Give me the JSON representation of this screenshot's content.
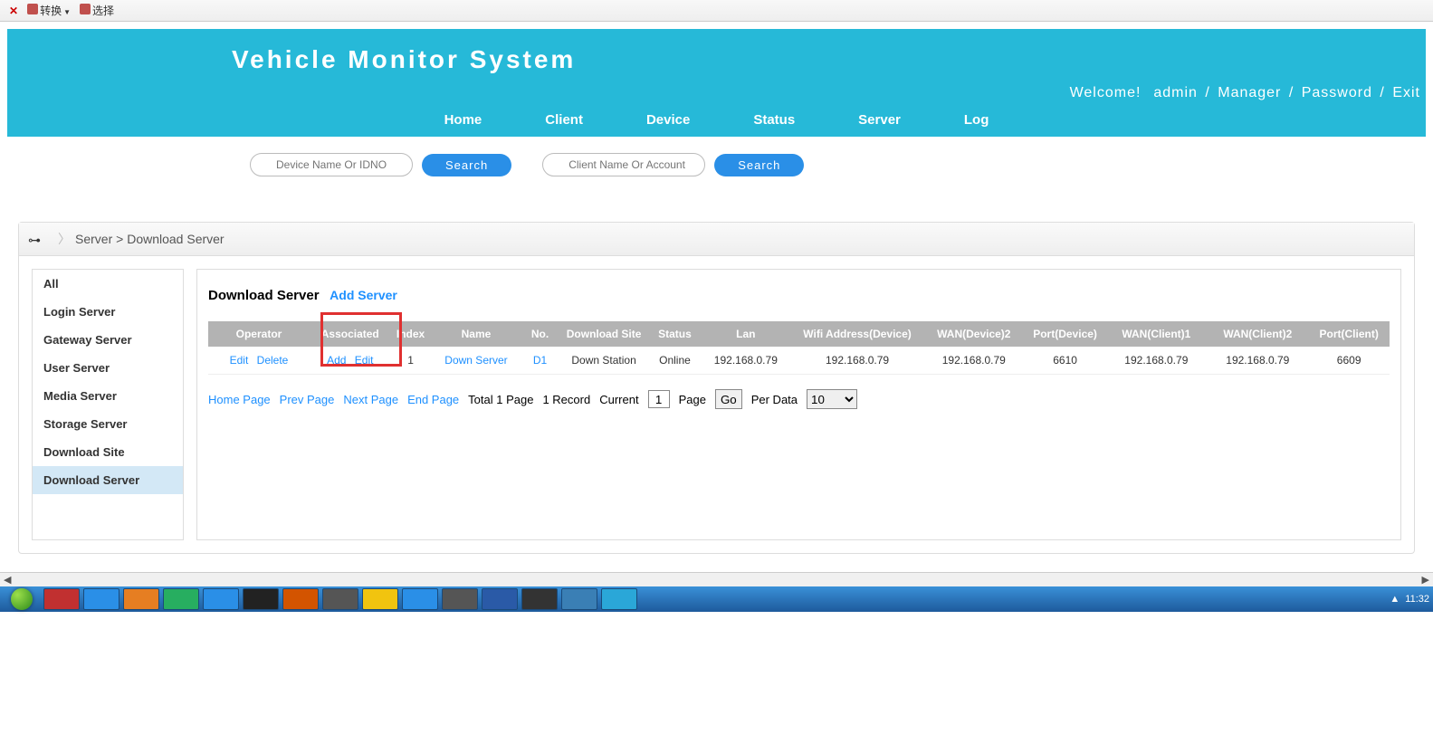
{
  "browser_bar": {
    "convert": "转换",
    "select": "选择"
  },
  "header": {
    "title": "Vehicle Monitor System",
    "welcome": "Welcome!",
    "user": "admin",
    "role": "Manager",
    "password": "Password",
    "exit": "Exit"
  },
  "nav": {
    "home": "Home",
    "client": "Client",
    "device": "Device",
    "status": "Status",
    "server": "Server",
    "log": "Log"
  },
  "search": {
    "device_placeholder": "Device Name Or IDNO",
    "client_placeholder": "Client Name Or Account",
    "button": "Search"
  },
  "breadcrumb": {
    "server": "Server",
    "download_server": "Download Server"
  },
  "sidebar": {
    "items": [
      {
        "label": "All"
      },
      {
        "label": "Login Server"
      },
      {
        "label": "Gateway Server"
      },
      {
        "label": "User Server"
      },
      {
        "label": "Media Server"
      },
      {
        "label": "Storage Server"
      },
      {
        "label": "Download Site"
      },
      {
        "label": "Download Server"
      }
    ]
  },
  "panel": {
    "title": "Download Server",
    "add_server": "Add Server"
  },
  "table": {
    "headers": {
      "operator": "Operator",
      "associated": "Associated",
      "index": "Index",
      "name": "Name",
      "no": "No.",
      "download_site": "Download Site",
      "status": "Status",
      "lan": "Lan",
      "wifi_addr_device": "Wifi Address(Device)",
      "wan_device2": "WAN(Device)2",
      "port_device": "Port(Device)",
      "wan_client1": "WAN(Client)1",
      "wan_client2": "WAN(Client)2",
      "port_client": "Port(Client)"
    },
    "rows": [
      {
        "op_edit": "Edit",
        "op_delete": "Delete",
        "assoc_add": "Add",
        "assoc_edit": "Edit",
        "index": "1",
        "name": "Down Server",
        "no": "D1",
        "download_site": "Down Station",
        "status": "Online",
        "lan": "192.168.0.79",
        "wifi_addr_device": "192.168.0.79",
        "wan_device2": "192.168.0.79",
        "port_device": "6610",
        "wan_client1": "192.168.0.79",
        "wan_client2": "192.168.0.79",
        "port_client": "6609"
      }
    ]
  },
  "pagination": {
    "home_page": "Home Page",
    "prev_page": "Prev Page",
    "next_page": "Next Page",
    "end_page": "End Page",
    "total": "Total 1 Page",
    "record": "1 Record",
    "current_label": "Current",
    "current_value": "1",
    "page_label": "Page",
    "go": "Go",
    "per_data": "Per Data",
    "per_data_value": "10"
  },
  "taskbar": {
    "time": "11:32"
  }
}
